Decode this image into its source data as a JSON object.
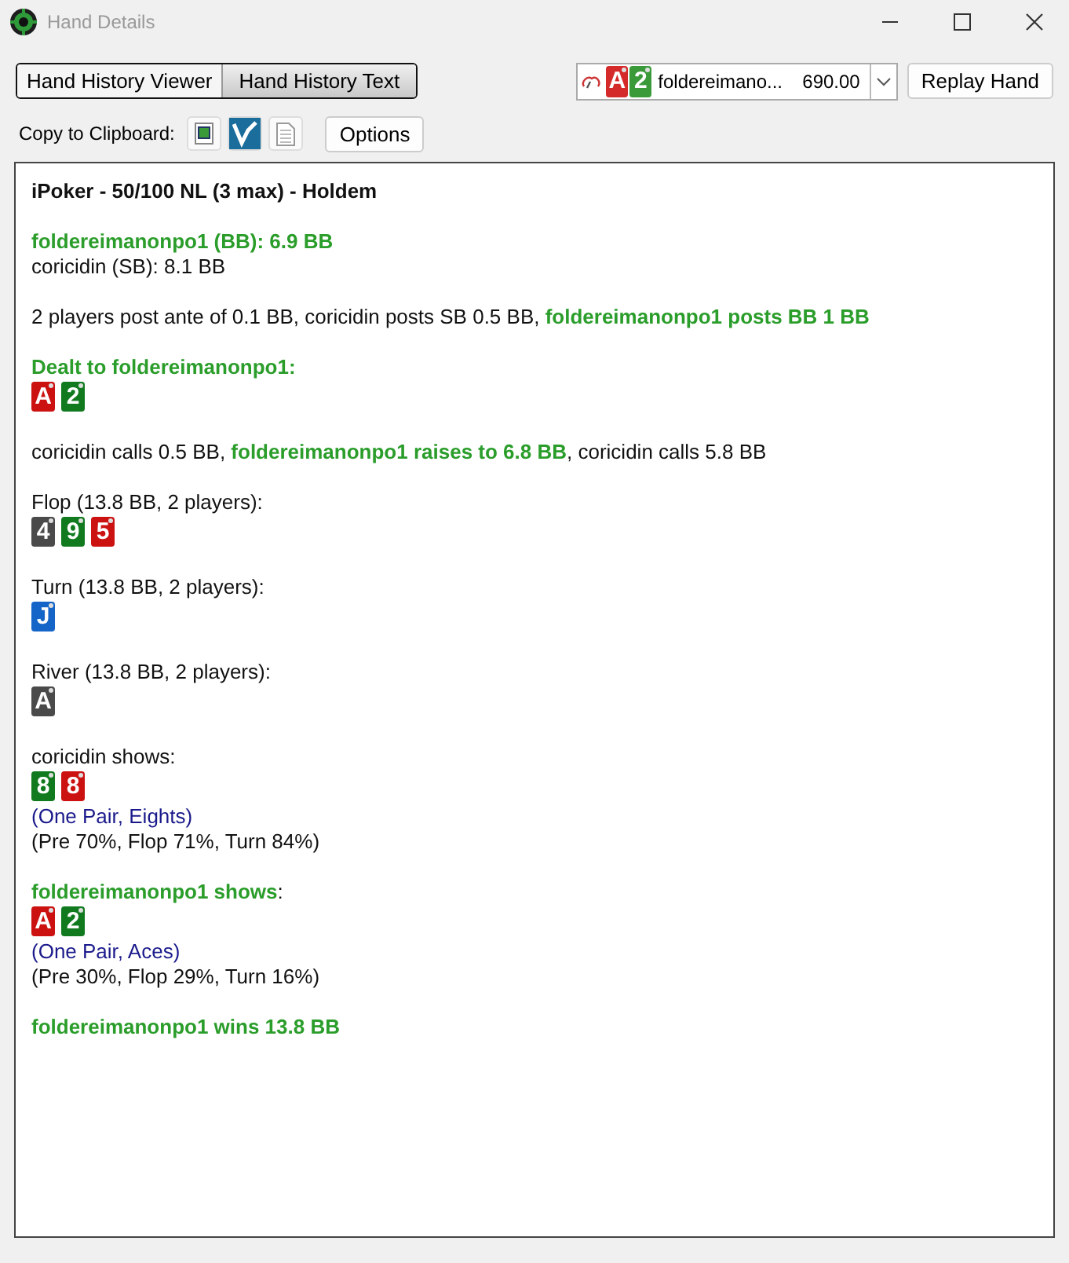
{
  "window": {
    "title": "Hand Details"
  },
  "view_tabs": [
    {
      "label": "Hand History Viewer",
      "selected": false
    },
    {
      "label": "Hand History Text",
      "selected": true
    }
  ],
  "hand_selector": {
    "cards": [
      {
        "rank": "A",
        "color": "#d42a2a"
      },
      {
        "rank": "2",
        "color": "#3a9a3a"
      }
    ],
    "player": "foldereimano...",
    "amount": "690.00"
  },
  "replay_button": "Replay Hand",
  "copy_label": "Copy to Clipboard:",
  "options_button": "Options",
  "history": [
    {
      "lines": [
        {
          "kind": "text",
          "segments": [
            {
              "kind": "title",
              "text": "iPoker - 50/100 NL (3 max) - Holdem"
            }
          ]
        }
      ]
    },
    {
      "lines": [
        {
          "kind": "text",
          "segments": [
            {
              "kind": "hero",
              "text": "foldereimanonpo1 (BB): 6.9 BB"
            }
          ]
        },
        {
          "kind": "text",
          "segments": [
            {
              "kind": "plain",
              "text": "coricidin (SB): 8.1 BB"
            }
          ]
        }
      ]
    },
    {
      "lines": [
        {
          "kind": "text",
          "segments": [
            {
              "kind": "plain",
              "text": "2 players post ante of 0.1 BB, coricidin posts SB 0.5 BB, "
            },
            {
              "kind": "hero",
              "text": "foldereimanonpo1 posts BB 1 BB"
            }
          ]
        }
      ]
    },
    {
      "lines": [
        {
          "kind": "text",
          "segments": [
            {
              "kind": "hero",
              "text": "Dealt to foldereimanonpo1:"
            }
          ]
        },
        {
          "kind": "cards",
          "cards": [
            {
              "rank": "A",
              "color": "#cc1111"
            },
            {
              "rank": "2",
              "color": "#117a1f"
            }
          ]
        }
      ]
    },
    {
      "lines": [
        {
          "kind": "text",
          "segments": [
            {
              "kind": "plain",
              "text": "coricidin calls 0.5 BB, "
            },
            {
              "kind": "hero",
              "text": "foldereimanonpo1 raises to 6.8 BB"
            },
            {
              "kind": "plain",
              "text": ", coricidin calls 5.8 BB"
            }
          ]
        }
      ]
    },
    {
      "lines": [
        {
          "kind": "text",
          "segments": [
            {
              "kind": "plain",
              "text": "Flop (13.8 BB, 2 players):"
            }
          ]
        },
        {
          "kind": "cards",
          "cards": [
            {
              "rank": "4",
              "color": "#4a4a4a"
            },
            {
              "rank": "9",
              "color": "#117a1f"
            },
            {
              "rank": "5",
              "color": "#cc1111"
            }
          ]
        }
      ]
    },
    {
      "lines": [
        {
          "kind": "text",
          "segments": [
            {
              "kind": "plain",
              "text": "Turn (13.8 BB, 2 players):"
            }
          ]
        },
        {
          "kind": "cards",
          "cards": [
            {
              "rank": "J",
              "color": "#1565c8"
            }
          ]
        }
      ]
    },
    {
      "lines": [
        {
          "kind": "text",
          "segments": [
            {
              "kind": "plain",
              "text": "River (13.8 BB, 2 players):"
            }
          ]
        },
        {
          "kind": "cards",
          "cards": [
            {
              "rank": "A",
              "color": "#4a4a4a"
            }
          ]
        }
      ]
    },
    {
      "lines": [
        {
          "kind": "text",
          "segments": [
            {
              "kind": "plain",
              "text": "coricidin shows:"
            }
          ]
        },
        {
          "kind": "cards",
          "cards": [
            {
              "rank": "8",
              "color": "#117a1f"
            },
            {
              "rank": "8",
              "color": "#cc1111"
            }
          ]
        },
        {
          "kind": "text",
          "segments": [
            {
              "kind": "info",
              "text": "(One Pair, Eights)"
            }
          ]
        },
        {
          "kind": "text",
          "segments": [
            {
              "kind": "plain",
              "text": "(Pre 70%, Flop 71%, Turn 84%)"
            }
          ]
        }
      ]
    },
    {
      "lines": [
        {
          "kind": "text",
          "segments": [
            {
              "kind": "hero",
              "text": "foldereimanonpo1 shows"
            },
            {
              "kind": "plain",
              "text": ":"
            }
          ]
        },
        {
          "kind": "cards",
          "cards": [
            {
              "rank": "A",
              "color": "#cc1111"
            },
            {
              "rank": "2",
              "color": "#117a1f"
            }
          ]
        },
        {
          "kind": "text",
          "segments": [
            {
              "kind": "info",
              "text": "(One Pair, Aces)"
            }
          ]
        },
        {
          "kind": "text",
          "segments": [
            {
              "kind": "plain",
              "text": "(Pre 30%, Flop 29%, Turn 16%)"
            }
          ]
        }
      ]
    },
    {
      "lines": [
        {
          "kind": "text",
          "segments": [
            {
              "kind": "hero",
              "text": "foldereimanonpo1 wins 13.8 BB"
            }
          ]
        }
      ]
    }
  ]
}
